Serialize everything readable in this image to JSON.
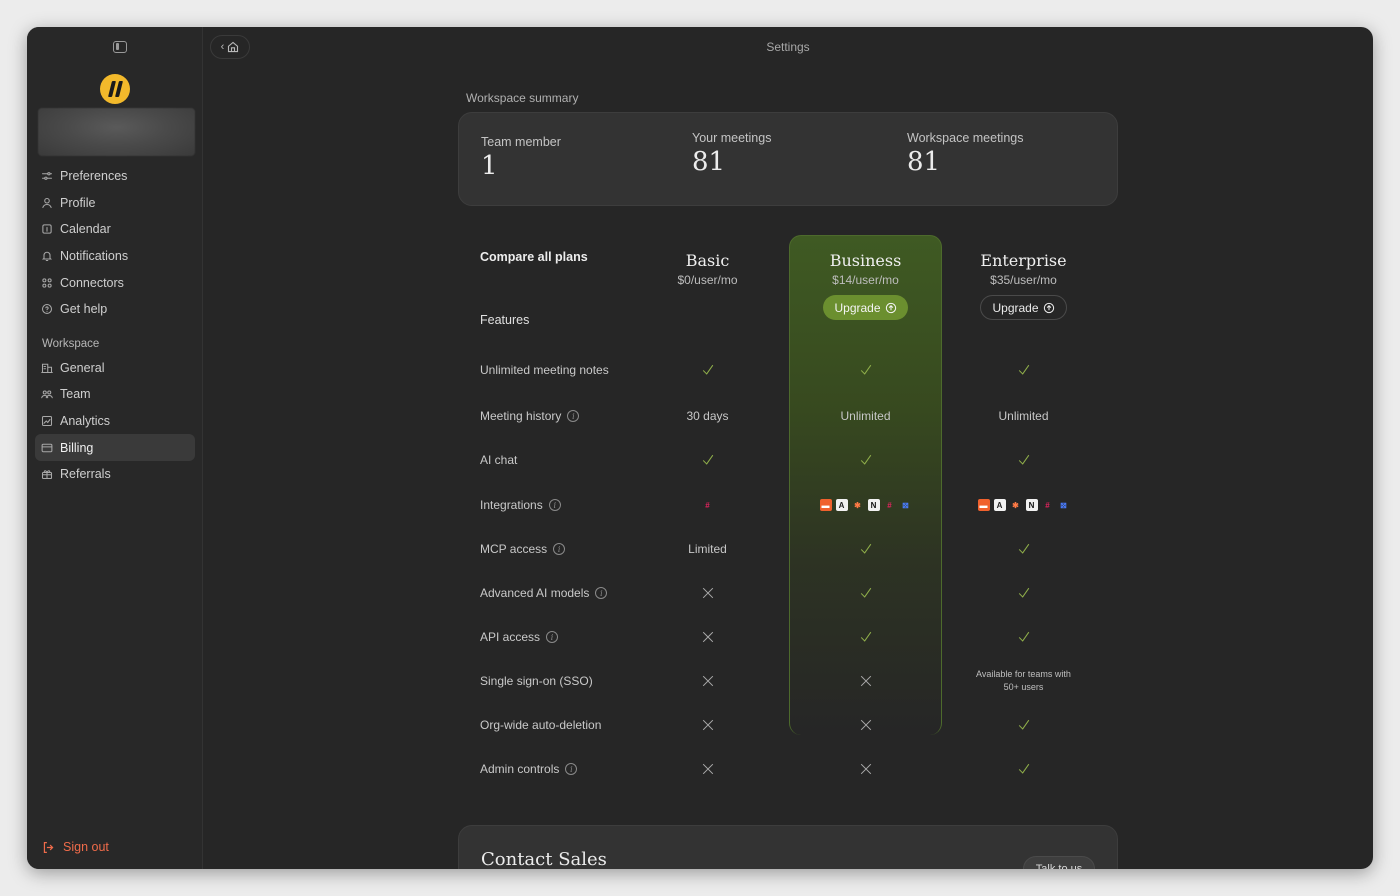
{
  "window": {
    "title": "Settings"
  },
  "sidebar": {
    "items": [
      {
        "label": "Preferences",
        "icon": "sliders-icon"
      },
      {
        "label": "Profile",
        "icon": "user-icon"
      },
      {
        "label": "Calendar",
        "icon": "calendar-icon"
      },
      {
        "label": "Notifications",
        "icon": "bell-icon"
      },
      {
        "label": "Connectors",
        "icon": "grid-icon"
      },
      {
        "label": "Get help",
        "icon": "help-icon"
      }
    ],
    "workspace_label": "Workspace",
    "workspace_items": [
      {
        "label": "General",
        "icon": "building-icon"
      },
      {
        "label": "Team",
        "icon": "team-icon"
      },
      {
        "label": "Analytics",
        "icon": "chart-icon"
      },
      {
        "label": "Billing",
        "icon": "card-icon",
        "active": true
      },
      {
        "label": "Referrals",
        "icon": "gift-icon"
      }
    ],
    "signout": "Sign out"
  },
  "summary": {
    "label": "Workspace summary",
    "stats": [
      {
        "label": "Team member",
        "value": "1"
      },
      {
        "label": "Your meetings",
        "value": "81"
      },
      {
        "label": "Workspace meetings",
        "value": "81"
      }
    ]
  },
  "plans": {
    "compare_title": "Compare all plans",
    "features_title": "Features",
    "columns": [
      {
        "name": "Basic",
        "price": "$0/user/mo",
        "upgrade": ""
      },
      {
        "name": "Business",
        "price": "$14/user/mo",
        "upgrade": "Upgrade"
      },
      {
        "name": "Enterprise",
        "price": "$35/user/mo",
        "upgrade": "Upgrade"
      }
    ],
    "rows": [
      {
        "label": "Unlimited meeting notes",
        "info": false,
        "cells": [
          "check",
          "check",
          "check"
        ]
      },
      {
        "label": "Meeting history",
        "info": true,
        "cells": [
          "30 days",
          "Unlimited",
          "Unlimited"
        ]
      },
      {
        "label": "AI chat",
        "info": false,
        "cells": [
          "check",
          "check",
          "check"
        ]
      },
      {
        "label": "Integrations",
        "info": true,
        "cells": [
          "integrations-basic",
          "integrations-full",
          "integrations-full"
        ]
      },
      {
        "label": "MCP access",
        "info": true,
        "cells": [
          "Limited",
          "check",
          "check"
        ]
      },
      {
        "label": "Advanced AI models",
        "info": true,
        "cells": [
          "x",
          "check",
          "check"
        ]
      },
      {
        "label": "API access",
        "info": true,
        "cells": [
          "x",
          "check",
          "check"
        ]
      },
      {
        "label": "Single sign-on (SSO)",
        "info": false,
        "cells": [
          "x",
          "x",
          "Available for teams with 50+ users"
        ]
      },
      {
        "label": "Org-wide auto-deletion",
        "info": false,
        "cells": [
          "x",
          "x",
          "check"
        ]
      },
      {
        "label": "Admin controls",
        "info": true,
        "cells": [
          "x",
          "x",
          "check"
        ]
      }
    ]
  },
  "contact": {
    "title": "Contact Sales",
    "button": "Talk to us"
  },
  "colors": {
    "accent_green": "#6b8f2f",
    "check_green": "#8fae4a",
    "signout": "#ef6b4a",
    "logo": "#f2b92b"
  }
}
